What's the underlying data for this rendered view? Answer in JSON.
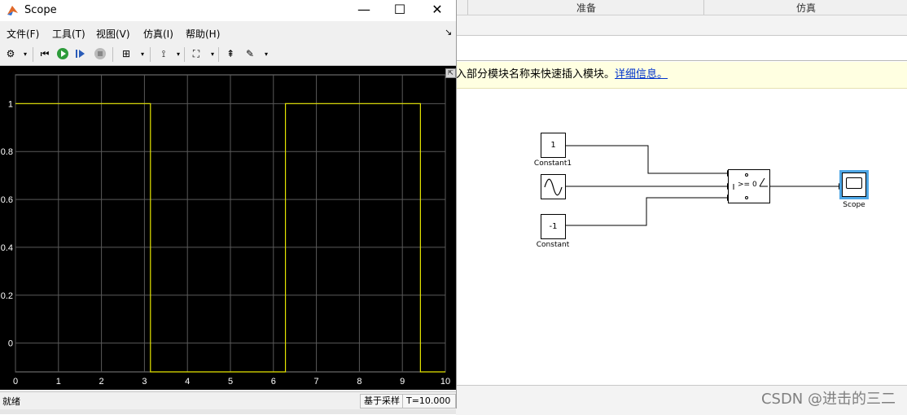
{
  "scope_window": {
    "title": "Scope",
    "controls": {
      "minimize": "—",
      "maximize": "☐",
      "close": "✕"
    },
    "menu": [
      "文件(F)",
      "工具(T)",
      "视图(V)",
      "仿真(I)",
      "帮助(H)"
    ],
    "status": {
      "left": "就绪",
      "sample_mode": "基于采样",
      "time": "T=10.000"
    }
  },
  "toolbar_icons": [
    "gear-icon",
    "step-back-icon",
    "run-icon",
    "step-forward-icon",
    "stop-icon",
    "highlight-icon",
    "cursor-icon",
    "zoom-fit-icon",
    "style-icon",
    "edit-icon"
  ],
  "model": {
    "header_tabs": [
      "准备",
      "仿真"
    ],
    "info_text": "入部分模块名称来快速插入模块。",
    "info_link": "详细信息。",
    "blocks": {
      "constant1": {
        "value": "1",
        "label": "Constant1"
      },
      "sine": {
        "label": ""
      },
      "constant": {
        "value": "-1",
        "label": "Constant"
      },
      "switch": {
        "condition": ">= 0"
      },
      "scope": {
        "label": "Scope"
      }
    }
  },
  "watermark": "CSDN @进击的三二",
  "chart_data": {
    "type": "line",
    "title": "",
    "xlabel": "",
    "ylabel": "",
    "xlim": [
      0,
      10
    ],
    "ylim": [
      -0.12,
      1.12
    ],
    "x_ticks": [
      "0",
      "1",
      "2",
      "3",
      "4",
      "5",
      "6",
      "7",
      "8",
      "9",
      "10"
    ],
    "y_ticks": [
      "0",
      "0.2",
      "0.4",
      "0.6",
      "0.8",
      "1"
    ],
    "grid": true,
    "colors": {
      "line": "#e6e600",
      "background": "#000000",
      "grid": "#5a5a5a",
      "tick_text": "#ffffff"
    },
    "series": [
      {
        "x": [
          0,
          3.14,
          3.14,
          6.28,
          6.28,
          9.42,
          9.42,
          10
        ],
        "y": [
          1,
          1,
          -0.12,
          -0.12,
          1,
          1,
          -0.12,
          -0.12
        ]
      }
    ]
  }
}
